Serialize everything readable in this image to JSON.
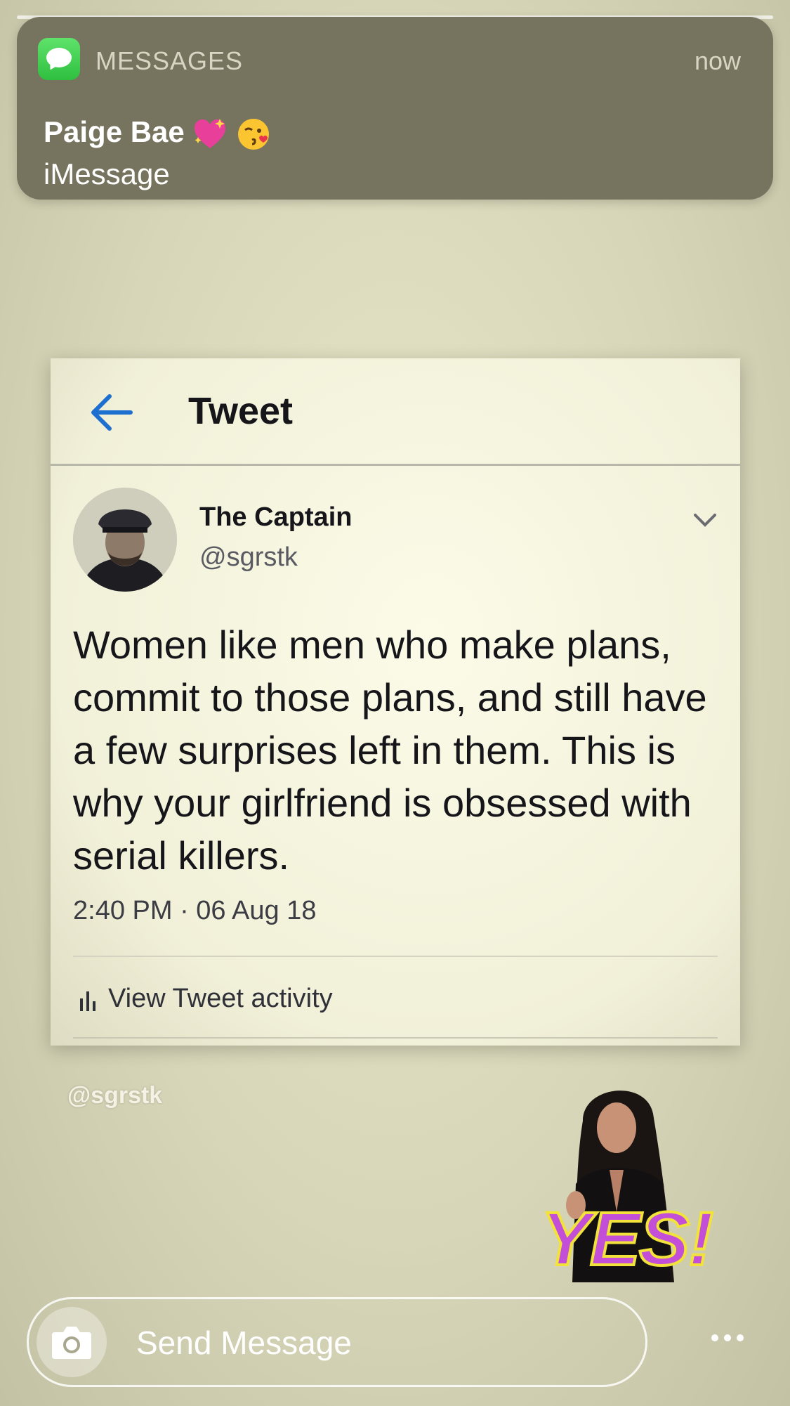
{
  "notification": {
    "app_name": "MESSAGES",
    "time": "now",
    "sender": "Paige Bae",
    "preview": "iMessage",
    "icon": "messages-app-icon",
    "emojis": [
      "sparkling-heart-icon",
      "kissing-face-icon"
    ]
  },
  "tweet": {
    "header_title": "Tweet",
    "author_name": "The Captain",
    "author_handle": "@sgrstk",
    "body": "Women like men who make plans, commit to those plans, and still have a few surprises left in them. This is why your girlfriend is obsessed with serial killers.",
    "timestamp": "2:40 PM · 06 Aug 18",
    "activity_label": "View Tweet activity"
  },
  "watermark": "@sgrstk",
  "sticker": {
    "text": "YES!"
  },
  "composer": {
    "placeholder": "Send Message",
    "camera_icon": "camera-icon",
    "more_icon": "more-dots-icon"
  },
  "colors": {
    "notification_bg": "#76735e",
    "twitter_blue": "#1d6fd0",
    "sticker_purple": "#c34fd8"
  }
}
